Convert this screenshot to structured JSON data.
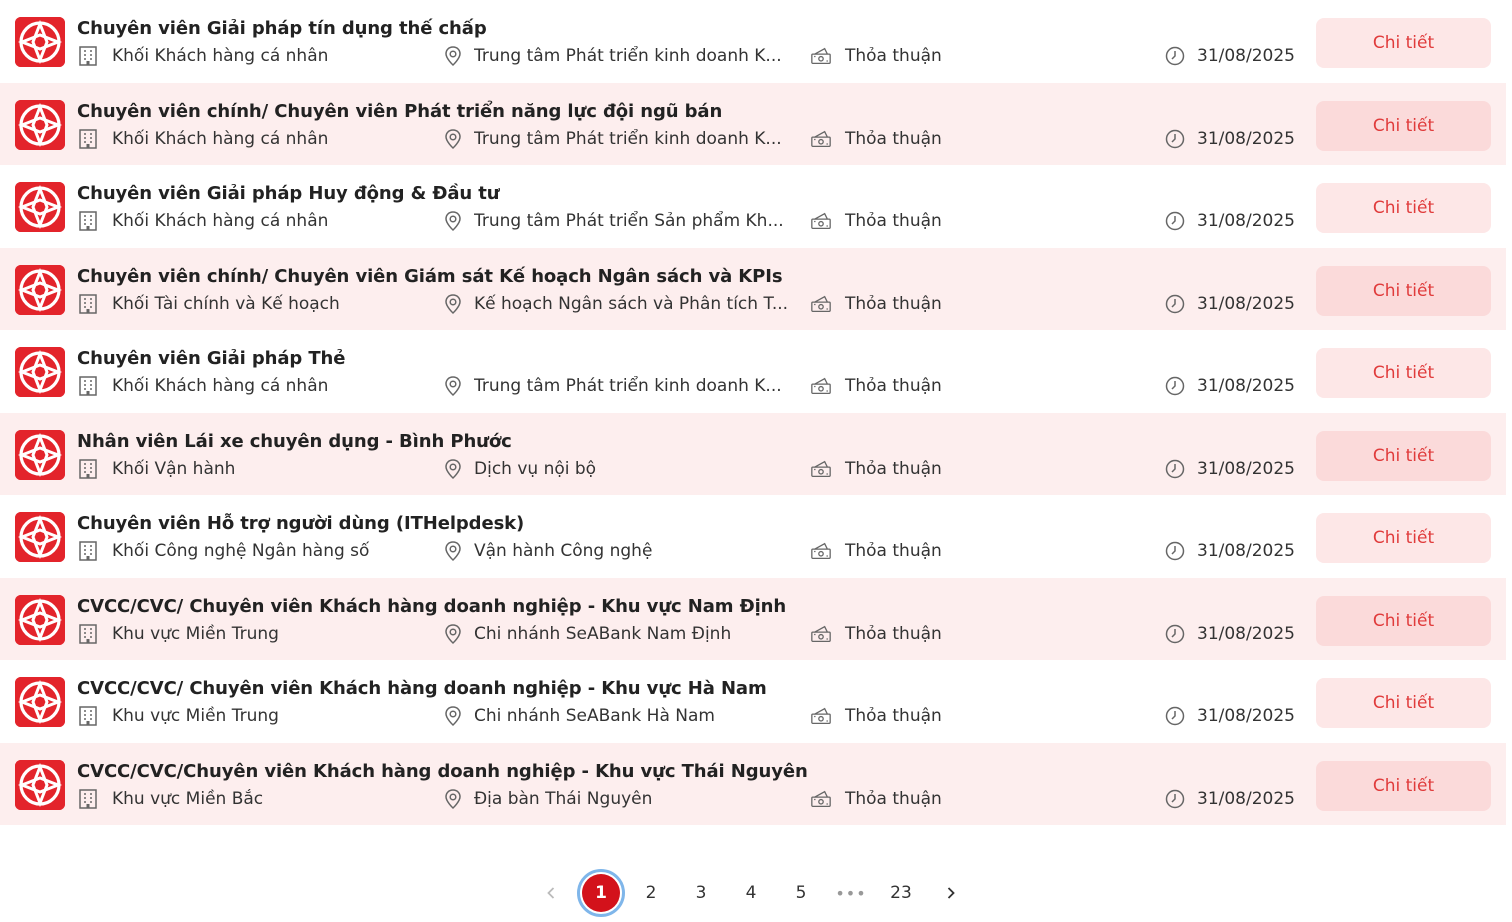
{
  "colors": {
    "brand": "#e3242b",
    "accent_text": "#e03b3b",
    "active_page": "#d3121b",
    "row_alt": "#fdeeee"
  },
  "icons": {
    "logo": "seabank-logo-icon",
    "department": "building-icon",
    "location": "location-pin-icon",
    "salary": "money-icon",
    "deadline": "clock-icon"
  },
  "jobs": [
    {
      "title": "Chuyên viên Giải pháp tín dụng thế chấp",
      "department": "Khối Khách hàng cá nhân",
      "location": "Trung tâm Phát triển kinh doanh K...",
      "salary": "Thỏa thuận",
      "deadline": "31/08/2025",
      "button": "Chi tiết"
    },
    {
      "title": "Chuyên viên chính/ Chuyên viên Phát triển năng lực đội ngũ bán",
      "department": "Khối Khách hàng cá nhân",
      "location": "Trung tâm Phát triển kinh doanh K...",
      "salary": "Thỏa thuận",
      "deadline": "31/08/2025",
      "button": "Chi tiết"
    },
    {
      "title": "Chuyên viên Giải pháp Huy động & Đầu tư",
      "department": "Khối Khách hàng cá nhân",
      "location": "Trung tâm Phát triển Sản phẩm Kh...",
      "salary": "Thỏa thuận",
      "deadline": "31/08/2025",
      "button": "Chi tiết"
    },
    {
      "title": "Chuyên viên chính/ Chuyên viên Giám sát Kế hoạch Ngân sách và KPIs",
      "department": "Khối Tài chính và Kế hoạch",
      "location": "Kế hoạch Ngân sách và Phân tích T...",
      "salary": "Thỏa thuận",
      "deadline": "31/08/2025",
      "button": "Chi tiết"
    },
    {
      "title": "Chuyên viên Giải pháp Thẻ",
      "department": "Khối Khách hàng cá nhân",
      "location": "Trung tâm Phát triển kinh doanh K...",
      "salary": "Thỏa thuận",
      "deadline": "31/08/2025",
      "button": "Chi tiết"
    },
    {
      "title": "Nhân viên Lái xe chuyên dụng - Bình Phước",
      "department": "Khối Vận hành",
      "location": "Dịch vụ nội bộ",
      "salary": "Thỏa thuận",
      "deadline": "31/08/2025",
      "button": "Chi tiết"
    },
    {
      "title": "Chuyên viên Hỗ trợ người dùng (ITHelpdesk)",
      "department": "Khối Công nghệ Ngân hàng số",
      "location": "Vận hành Công nghệ",
      "salary": "Thỏa thuận",
      "deadline": "31/08/2025",
      "button": "Chi tiết"
    },
    {
      "title": "CVCC/CVC/ Chuyên viên Khách hàng doanh nghiệp - Khu vực Nam Định",
      "department": "Khu vực Miền Trung",
      "location": "Chi nhánh SeABank Nam Định",
      "salary": "Thỏa thuận",
      "deadline": "31/08/2025",
      "button": "Chi tiết"
    },
    {
      "title": "CVCC/CVC/ Chuyên viên Khách hàng doanh nghiệp - Khu vực Hà Nam",
      "department": "Khu vực Miền Trung",
      "location": "Chi nhánh SeABank Hà Nam",
      "salary": "Thỏa thuận",
      "deadline": "31/08/2025",
      "button": "Chi tiết"
    },
    {
      "title": "CVCC/CVC/Chuyên viên Khách hàng doanh nghiệp - Khu vực Thái Nguyên",
      "department": "Khu vực Miền Bắc",
      "location": "Địa bàn Thái Nguyên",
      "salary": "Thỏa thuận",
      "deadline": "31/08/2025",
      "button": "Chi tiết"
    }
  ],
  "pagination": {
    "current": "1",
    "pages": [
      "1",
      "2",
      "3",
      "4",
      "5"
    ],
    "ellipsis": "•••",
    "last": "23",
    "prev_icon": "chevron-left-icon",
    "next_icon": "chevron-right-icon"
  }
}
